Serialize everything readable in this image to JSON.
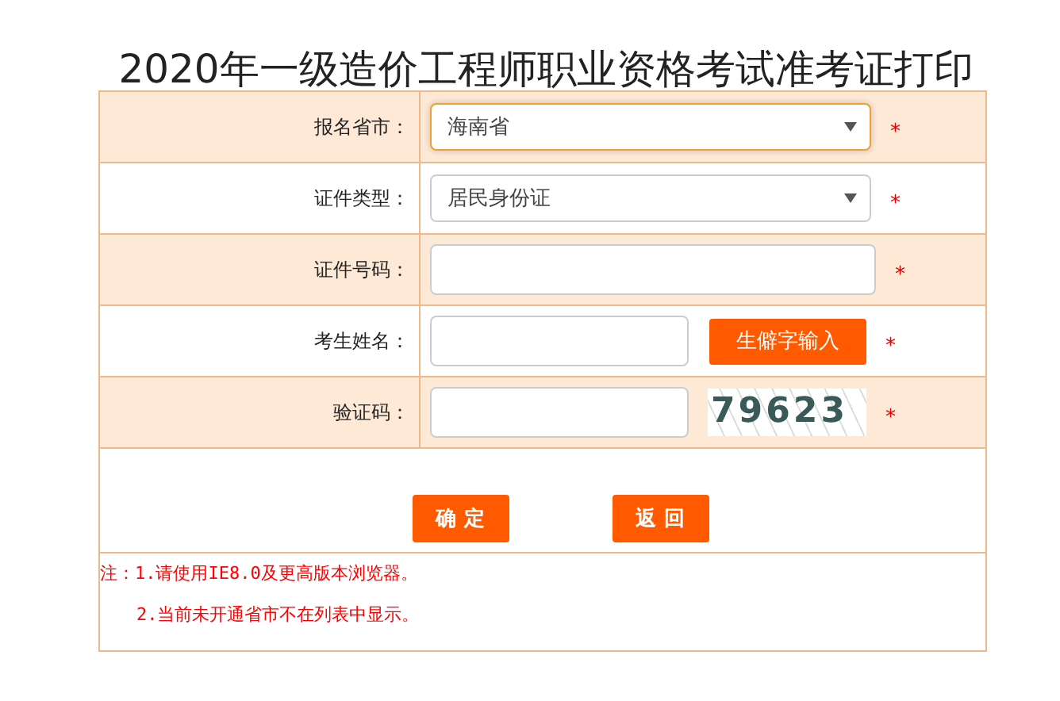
{
  "title": "2020年一级造价工程师职业资格考试准考证打印",
  "form_rows": [
    {
      "kind": "select",
      "label": "报名省市：",
      "value": "海南省",
      "focused": true,
      "required_mark": "*"
    },
    {
      "kind": "select",
      "label": "证件类型：",
      "value": "居民身份证",
      "focused": false,
      "required_mark": "*"
    },
    {
      "kind": "input",
      "label": "证件号码：",
      "required_mark": "*"
    },
    {
      "kind": "input_button",
      "label": "考生姓名：",
      "button": "生僻字输入",
      "required_mark": "*"
    },
    {
      "kind": "captcha",
      "label": "验证码：",
      "captcha": "79623",
      "required_mark": "*"
    }
  ],
  "buttons": [
    "确 定",
    "返 回"
  ],
  "notes": [
    "注：1.请使用IE8.0及更高版本浏览器。",
    "2.当前未开通省市不在列表中显示。"
  ]
}
